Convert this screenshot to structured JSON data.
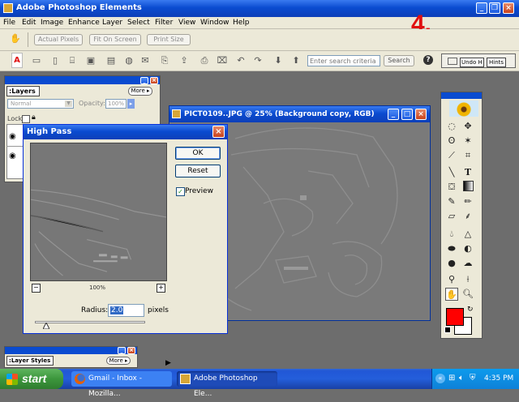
{
  "app": {
    "title": "Adobe Photoshop Elements",
    "menu": [
      "File",
      "Edit",
      "Image",
      "Enhance",
      "Layer",
      "Select",
      "Filter",
      "View",
      "Window",
      "Help"
    ],
    "step_label": "4.",
    "options_bar": {
      "actual_pixels": "Actual Pixels",
      "fit_on_screen": "Fit On Screen",
      "print_size": "Print Size"
    },
    "search": {
      "placeholder": "Enter search criteria",
      "button": "Search"
    },
    "palette_well": {
      "undo": "Undo H",
      "hints": "Hints"
    }
  },
  "layers_palette": {
    "title": "Layers",
    "more": "More",
    "blend_mode": "Normal",
    "opacity_label": "Opacity:",
    "opacity_value": "100%",
    "lock_label": "Lock:"
  },
  "layer_styles": {
    "title": "Layer Styles",
    "more": "More"
  },
  "document": {
    "title": "PICT0109..JPG @ 25% (Background copy, RGB)"
  },
  "dialog": {
    "title": "High Pass",
    "ok": "OK",
    "reset": "Reset",
    "preview_label": "Preview",
    "preview_checked": true,
    "zoom": "100%",
    "radius_label": "Radius:",
    "radius_value": "2.0",
    "radius_unit": "pixels",
    "slider_level": 0.1
  },
  "colors": {
    "foreground": "#ff0000",
    "background": "#ffffff",
    "accent": "#0a4bd0"
  },
  "taskbar": {
    "start": "start",
    "tasks": [
      {
        "label": "Gmail - Inbox - Mozilla...",
        "icon": "firefox-icon"
      },
      {
        "label": "Adobe Photoshop Ele...",
        "icon": "photoshop-icon"
      }
    ],
    "clock": "4:35 PM"
  }
}
